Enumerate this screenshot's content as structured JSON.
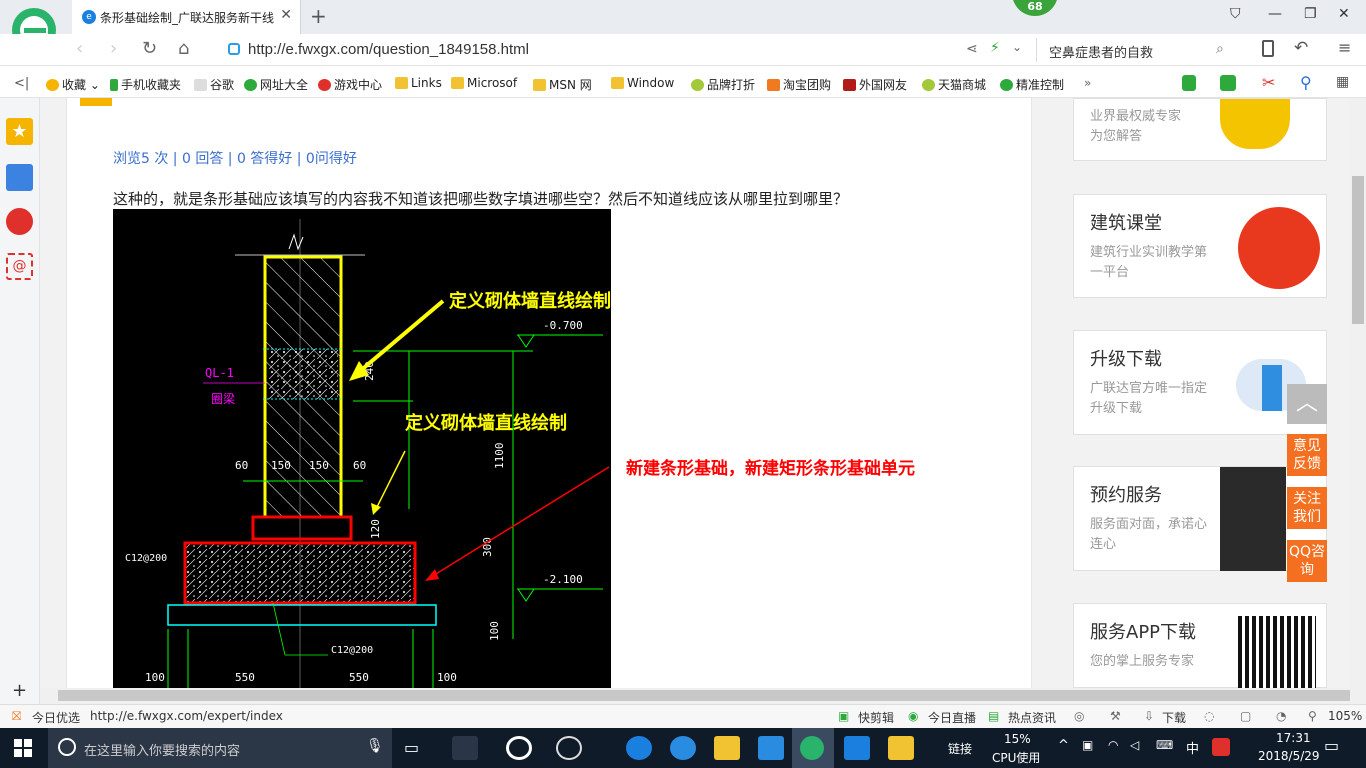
{
  "browser": {
    "tab_title": "条形基础绘制_广联达服务新干线",
    "badge": "68",
    "url": "http://e.fwxgx.com/question_1849158.html",
    "search_text": "空鼻症患者的自救"
  },
  "bookmarks": [
    "收藏",
    "手机收藏夹",
    "谷歌",
    "网址大全",
    "游戏中心",
    "Links",
    "Microsof",
    "MSN 网",
    "Window",
    "品牌打折",
    "淘宝团购",
    "外国网友",
    "天猫商城",
    "精准控制"
  ],
  "question": {
    "stats": "浏览5 次 | 0 回答 | 0 答得好 | 0问得好",
    "text": "这种的，就是条形基础应该填写的内容我不知道该把哪些数字填进哪些空？然后不知道线应该从哪里拉到哪里？",
    "annotation1": "定义砌体墙直线绘制",
    "annotation2": "定义砌体墙直线绘制",
    "annotation3": "新建条形基础，新建矩形条形基础单元",
    "cad": {
      "elev1": "-0.700",
      "elev2": "-2.100",
      "ql": "QL-1",
      "ql_cn": "圈梁",
      "dims_top": [
        "60",
        "150",
        "150",
        "60"
      ],
      "dim_240": "240",
      "dim_1100": "1100",
      "dim_120": "120",
      "dim_300": "300",
      "dim_100": "100",
      "rebar1": "C12@200",
      "rebar2": "C12@200",
      "dims_bottom": [
        "100",
        "550",
        "550",
        "100"
      ]
    }
  },
  "sidebar": {
    "top_card": [
      "业界最权威专家",
      "为您解答"
    ],
    "cards": [
      {
        "title": "建筑课堂",
        "desc": "建筑行业实训教学第一平台"
      },
      {
        "title": "升级下载",
        "desc": "广联达官方唯一指定升级下载"
      },
      {
        "title": "预约服务",
        "desc": "服务面对面，承诺心连心"
      },
      {
        "title": "服务APP下载",
        "desc": "您的掌上服务专家"
      }
    ],
    "float": [
      "意见反馈",
      "关注我们",
      "QQ咨询"
    ]
  },
  "statusbar": {
    "left": "今日优选",
    "link": "http://e.fwxgx.com/expert/index",
    "items": [
      "快剪辑",
      "今日直播",
      "热点资讯",
      "下载"
    ],
    "zoom": "105%"
  },
  "taskbar": {
    "search_placeholder": "在这里输入你要搜索的内容",
    "link": "链接",
    "cpu_pct": "15%",
    "cpu_label": "CPU使用",
    "ime": "中",
    "time": "17:31",
    "date": "2018/5/29"
  }
}
